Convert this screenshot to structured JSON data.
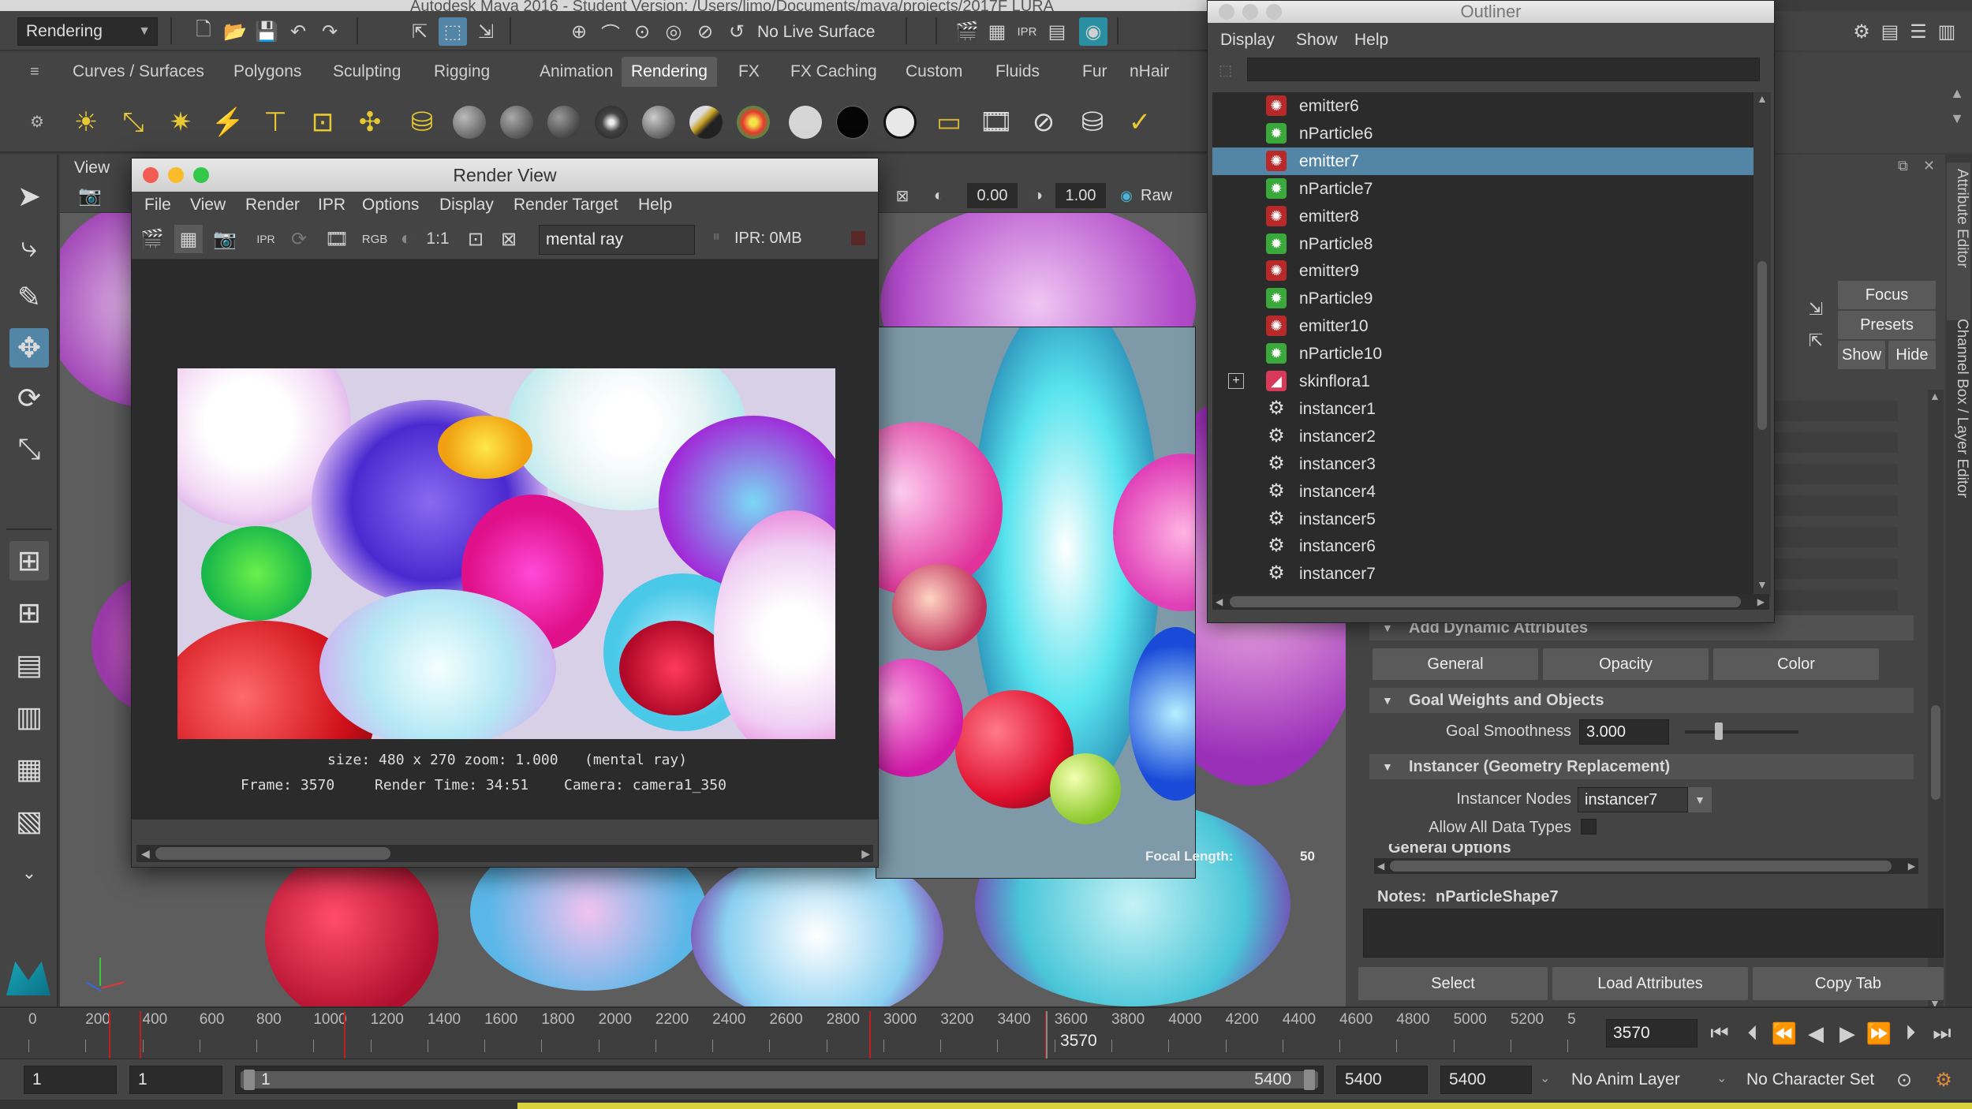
{
  "window_title": "Autodesk Maya 2016 - Student Version: /Users/limo/Documents/maya/projects/2017F LURA",
  "status_line": {
    "menu_set": "Rendering",
    "live_surface": "No Live Surface"
  },
  "shelf_tabs": [
    "Curves / Surfaces",
    "Polygons",
    "Sculpting",
    "Rigging",
    "Animation",
    "Rendering",
    "FX",
    "FX Caching",
    "Custom",
    "Fluids",
    "Fur",
    "nHair"
  ],
  "shelf_active_tab": "Rendering",
  "viewport": {
    "menu_view": "View",
    "exposure": "0.00",
    "gamma": "1.00",
    "color_space": "Raw",
    "camera_label": "camera1_350",
    "focal_label": "Focal Length:",
    "focal_value": "50"
  },
  "render_view": {
    "title": "Render View",
    "menus": [
      "File",
      "View",
      "Render",
      "IPR",
      "Options",
      "Display",
      "Render Target",
      "Help"
    ],
    "renderer": "mental ray",
    "ipr_memory": "IPR: 0MB",
    "rgb_label": "RGB",
    "ratio_label": "1:1",
    "info_line1": "size: 480 x 270 zoom: 1.000",
    "info_renderer": "(mental ray)",
    "frame": "Frame: 3570",
    "render_time": "Render Time: 34:51",
    "camera": "Camera: camera1_350"
  },
  "outliner": {
    "title": "Outliner",
    "menus": [
      "Display",
      "Show",
      "Help"
    ],
    "items": [
      {
        "label": "emitter6",
        "type": "emitter"
      },
      {
        "label": "nParticle6",
        "type": "particle"
      },
      {
        "label": "emitter7",
        "type": "emitter",
        "selected": true
      },
      {
        "label": "nParticle7",
        "type": "particle"
      },
      {
        "label": "emitter8",
        "type": "emitter"
      },
      {
        "label": "nParticle8",
        "type": "particle"
      },
      {
        "label": "emitter9",
        "type": "emitter"
      },
      {
        "label": "nParticle9",
        "type": "particle"
      },
      {
        "label": "emitter10",
        "type": "emitter"
      },
      {
        "label": "nParticle10",
        "type": "particle"
      },
      {
        "label": "skinflora1",
        "type": "mesh",
        "expandable": true
      },
      {
        "label": "instancer1",
        "type": "instancer"
      },
      {
        "label": "instancer2",
        "type": "instancer"
      },
      {
        "label": "instancer3",
        "type": "instancer"
      },
      {
        "label": "instancer4",
        "type": "instancer"
      },
      {
        "label": "instancer5",
        "type": "instancer"
      },
      {
        "label": "instancer6",
        "type": "instancer"
      },
      {
        "label": "instancer7",
        "type": "instancer"
      }
    ]
  },
  "attribute_editor": {
    "focus": "Focus",
    "presets": "Presets",
    "show": "Show",
    "hide": "Hide",
    "add_dynamic": "Add Dynamic Attributes",
    "dyn_buttons": [
      "General",
      "Opacity",
      "Color"
    ],
    "goal_section": "Goal Weights and Objects",
    "goal_smoothness_label": "Goal Smoothness",
    "goal_smoothness_value": "3.000",
    "goal_smoothness_level": 0.3,
    "instancer_section": "Instancer (Geometry Replacement)",
    "instancer_nodes_label": "Instancer Nodes",
    "instancer_nodes_value": "instancer7",
    "allow_all_label": "Allow All Data Types",
    "general_options": "General Options",
    "notes_label": "Notes:",
    "notes_value": "nParticleShape7",
    "select": "Select",
    "load_attributes": "Load Attributes",
    "copy_tab": "Copy Tab",
    "side_tabs": [
      "Attribute Editor",
      "Channel Box / Layer Editor"
    ]
  },
  "timeline": {
    "ticks": [
      "0",
      "200",
      "400",
      "600",
      "800",
      "1000",
      "1200",
      "1400",
      "1600",
      "1800",
      "2000",
      "2200",
      "2400",
      "2600",
      "2800",
      "3000",
      "3200",
      "3400",
      "3600",
      "3800",
      "4000",
      "4200",
      "4400",
      "4600",
      "4800",
      "5000",
      "5200",
      "5"
    ],
    "current_frame": "3570",
    "current_frame_field": "3570"
  },
  "range": {
    "start": "1",
    "playback_start": "1",
    "slider_start": "1",
    "slider_end": "5400",
    "playback_end": "5400",
    "end": "5400",
    "anim_layer": "No Anim Layer",
    "character_set": "No Character Set"
  },
  "colors": {
    "selection": "#5285a6",
    "panel": "#444444",
    "field": "#2b2b2b",
    "key_red": "#c02020"
  }
}
